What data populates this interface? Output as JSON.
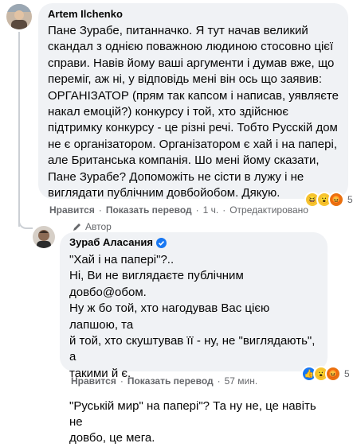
{
  "comment1": {
    "author": "Artem Ilchenko",
    "lines": [
      "Пане Зурабе, питанначко. Я тут начав великий",
      "скандал з однією поважною людиною стосовно цієї",
      "справи. Навів йому ваші аргументи і думав вже, що",
      "переміг, аж ні, у відповідь мені він ось що заявив:",
      "ОРГАНІЗАТОР (прям так капсом і написав, уявляєте",
      "накал емоцій?) конкурсу і той, хто здійснює",
      "підтримку конкурсу - це різні речі. Тобто Русскій дом",
      "не є організатором. Організатором є хай і на папері,",
      "але Британська компанія. Шо мені йому сказати,",
      "Пане Зурабе? Допоможіть не сісти в лужу і не",
      "виглядати публічним довбойобом. Дякую."
    ],
    "like": "Нравится",
    "translate": "Показать перевод",
    "time": "1 ч.",
    "edited": "Отредактировано",
    "reactions": [
      "haha",
      "wow",
      "angry"
    ],
    "reaction_count": "5"
  },
  "reply": {
    "badge": "Автор",
    "author": "Зураб Аласания",
    "verified": "verified-icon",
    "lines": [
      "\"Хай і на папері\"?..",
      "Ні, Ви не виглядаєте публічним довбо@обом.",
      "Ну ж бо той, хто нагодував Вас цією лапшою, та",
      "й той, хто скуштував її - ну, не \"виглядають\", а",
      "такими й є.",
      "",
      "\"Руській мир\" на папері\"? Та ну не, це навіть не",
      "довбо, це мега."
    ],
    "like": "Нравится",
    "translate": "Показать перевод",
    "time": "57 мин.",
    "reactions": [
      "like",
      "wow",
      "angry"
    ],
    "reaction_count": "5"
  }
}
